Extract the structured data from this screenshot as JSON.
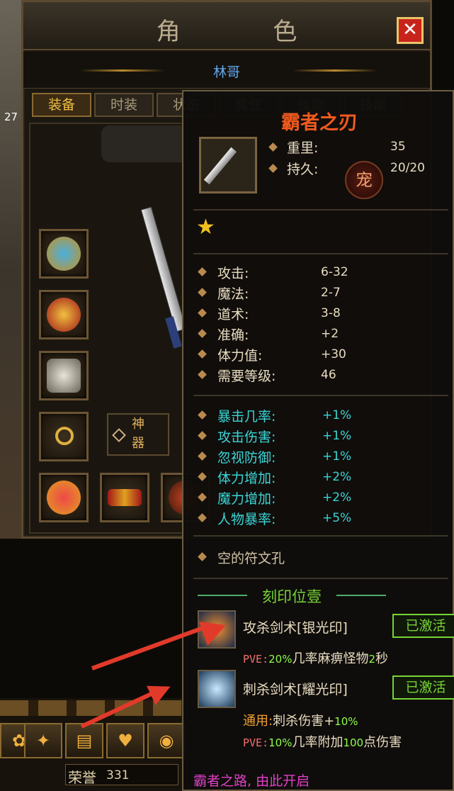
{
  "window": {
    "title": "角 色",
    "close": "✕",
    "player_name": "林哥",
    "side_number": "27"
  },
  "tabs": [
    {
      "label": "装备",
      "active": true
    },
    {
      "label": "时装",
      "active": false
    },
    {
      "label": "状态",
      "active": false
    },
    {
      "label": "属性",
      "active": false
    },
    {
      "label": "技能",
      "active": false
    },
    {
      "label": "技能",
      "active": false
    }
  ],
  "shenqi_label": "神器",
  "tooltip": {
    "name": "霸者之刃",
    "weight_label": "重里:",
    "weight_value": "35",
    "durability_label": "持久:",
    "durability_value": "20/20",
    "pet_badge": "宠",
    "base_stats": [
      {
        "label": "攻击:",
        "value": "6-32"
      },
      {
        "label": "魔法:",
        "value": "2-7"
      },
      {
        "label": "道术:",
        "value": "3-8"
      },
      {
        "label": "准确:",
        "value": "+2"
      },
      {
        "label": "体力值:",
        "value": "+30"
      },
      {
        "label": "需要等级:",
        "value": "46"
      }
    ],
    "special_stats": [
      {
        "label": "暴击几率:",
        "value": "+1%"
      },
      {
        "label": "攻击伤害:",
        "value": "+1%"
      },
      {
        "label": "忽视防御:",
        "value": "+1%"
      },
      {
        "label": "体力增加:",
        "value": "+2%"
      },
      {
        "label": "魔力增加:",
        "value": "+2%"
      },
      {
        "label": "人物暴率:",
        "value": "+5%"
      }
    ],
    "rune_slot": "空的符文孔",
    "seal_header": "刻印位壹",
    "seals": [
      {
        "name": "攻杀剑术[银光印]",
        "status": "已激活",
        "effect_prefix": "PVE:",
        "effect_pct": "20%",
        "effect_mid": "几率麻痹怪物",
        "effect_num": "2",
        "effect_end": "秒"
      },
      {
        "name": "刺杀剑术[耀光印]",
        "status": "已激活",
        "effect_line1_prefix": "通用:",
        "effect_line1_text": "刺杀伤害+",
        "effect_line1_pct": "10%",
        "effect_prefix": "PVE:",
        "effect_pct": "10%",
        "effect_mid": "几率附加",
        "effect_num": "100",
        "effect_end": "点伤害"
      }
    ]
  },
  "honor_label": "荣誉",
  "honor_value": "331",
  "bottom_message": "霸者之路, 由此开启",
  "colors": {
    "name_orange": "#f05a1e",
    "cyan": "#39d6d6",
    "green": "#77d436",
    "arrow": "#e23a2a"
  }
}
